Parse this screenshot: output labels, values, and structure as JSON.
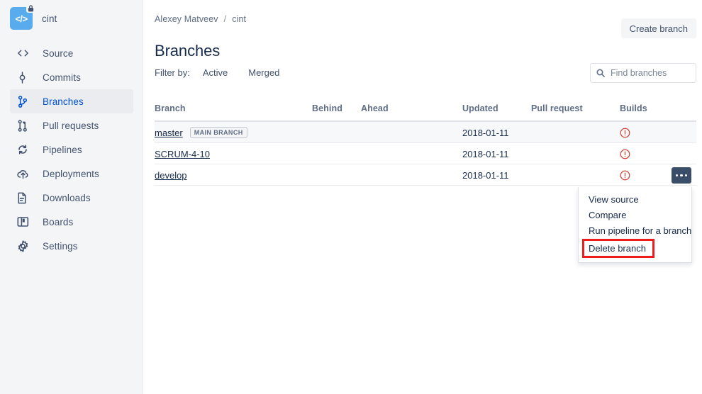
{
  "sidebar": {
    "repo": {
      "name": "cint",
      "avatar_icon": "code-icon",
      "lock_icon": "lock-icon",
      "avatar_color": "#58ACEE"
    },
    "items": [
      {
        "label": "Source",
        "icon": "source-code-icon",
        "active": false
      },
      {
        "label": "Commits",
        "icon": "commits-icon",
        "active": false
      },
      {
        "label": "Branches",
        "icon": "branches-icon",
        "active": true
      },
      {
        "label": "Pull requests",
        "icon": "pull-request-icon",
        "active": false
      },
      {
        "label": "Pipelines",
        "icon": "pipelines-icon",
        "active": false
      },
      {
        "label": "Deployments",
        "icon": "deployments-icon",
        "active": false
      },
      {
        "label": "Downloads",
        "icon": "downloads-icon",
        "active": false
      },
      {
        "label": "Boards",
        "icon": "boards-icon",
        "active": false
      },
      {
        "label": "Settings",
        "icon": "settings-gear-icon",
        "active": false
      }
    ],
    "active_color": "#0052CC",
    "background": "#F4F5F7"
  },
  "header": {
    "breadcrumb": {
      "owner": "Alexey Matveev",
      "separator": "/",
      "repo": "cint"
    },
    "title": "Branches",
    "create_branch_label": "Create branch"
  },
  "filters": {
    "label": "Filter by:",
    "tabs": [
      {
        "label": "Active"
      },
      {
        "label": "Merged"
      }
    ]
  },
  "search": {
    "placeholder": "Find branches",
    "value": "",
    "icon": "search-icon"
  },
  "table": {
    "columns": [
      "Branch",
      "Behind",
      "Ahead",
      "Updated",
      "Pull request",
      "Builds"
    ],
    "rows": [
      {
        "branch": "master",
        "badge": "MAIN BRANCH",
        "behind": "",
        "ahead": "",
        "updated": "2018-01-11",
        "pull_request": "",
        "build_status": "error",
        "build_icon": "error-circle-icon"
      },
      {
        "branch": "SCRUM-4-10",
        "badge": "",
        "behind": "",
        "ahead": "",
        "updated": "2018-01-11",
        "pull_request": "",
        "build_status": "error",
        "build_icon": "error-circle-icon"
      },
      {
        "branch": "develop",
        "badge": "",
        "behind": "",
        "ahead": "",
        "updated": "2018-01-11",
        "pull_request": "",
        "build_status": "error",
        "build_icon": "error-circle-icon"
      }
    ],
    "build_error_color": "#D04437"
  },
  "actions_menu": {
    "trigger_icon": "ellipsis-icon",
    "trigger_color": "#3A4D69",
    "items": [
      {
        "label": "View source",
        "highlighted": false
      },
      {
        "label": "Compare",
        "highlighted": false
      },
      {
        "label": "Run pipeline for a branch",
        "highlighted": false
      },
      {
        "label": "Delete branch",
        "highlighted": true
      }
    ],
    "highlight_color": "#EE1C1C"
  }
}
